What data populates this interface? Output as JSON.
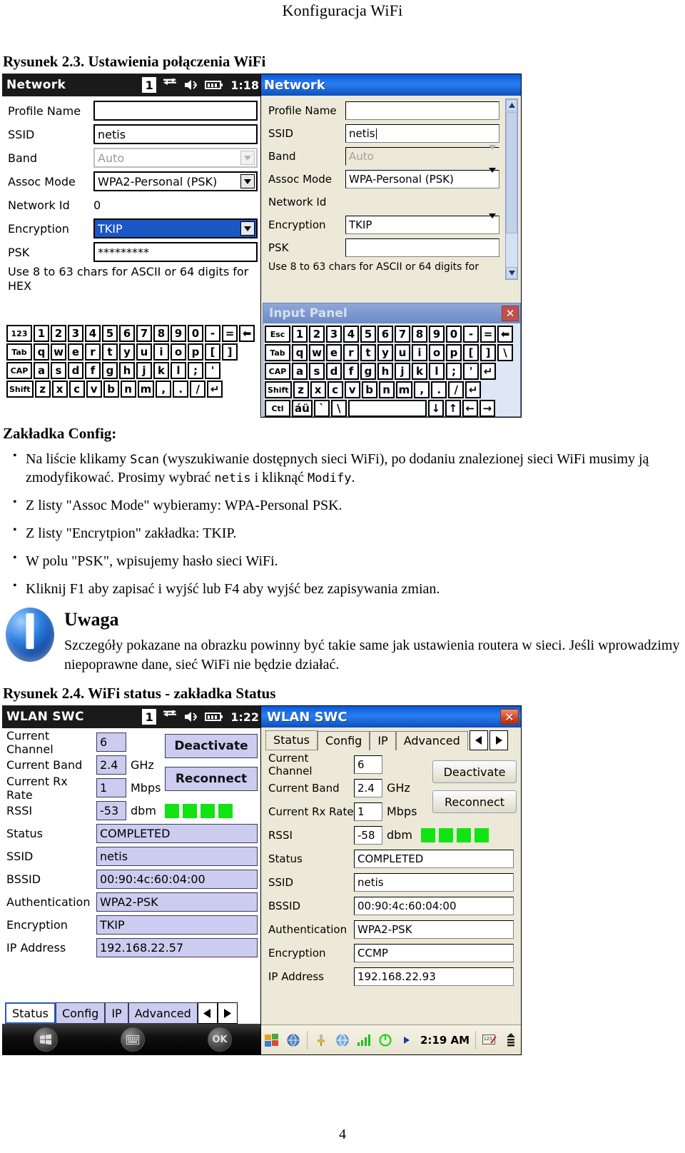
{
  "running_head": "Konfiguracja WiFi",
  "page_number": "4",
  "figure23": {
    "caption": "Rysunek 2.3. Ustawienia połączenia WiFi",
    "handheld": {
      "titlebar": {
        "title": "Network",
        "badge": "1",
        "clock": "1:18"
      },
      "fields": [
        {
          "label": "Profile Name",
          "value": "",
          "type": "text"
        },
        {
          "label": "SSID",
          "value": "netis",
          "type": "text"
        },
        {
          "label": "Band",
          "value": "Auto",
          "type": "combo-disabled"
        },
        {
          "label": "Assoc Mode",
          "value": "WPA2-Personal (PSK)",
          "type": "combo"
        },
        {
          "label": "Network Id",
          "value": "0",
          "type": "plain"
        },
        {
          "label": "Encryption",
          "value": "TKIP",
          "type": "combo-selected"
        },
        {
          "label": "PSK",
          "value": "*********",
          "type": "text"
        }
      ],
      "hint_line1": "Use 8 to 63 chars for ASCII or 64 digits for",
      "hint_line2": "HEX",
      "keyboard": {
        "row1": [
          "123",
          "1",
          "2",
          "3",
          "4",
          "5",
          "6",
          "7",
          "8",
          "9",
          "0",
          "-",
          "=",
          "⬅"
        ],
        "row2": [
          "Tab",
          "q",
          "w",
          "e",
          "r",
          "t",
          "y",
          "u",
          "i",
          "o",
          "p",
          "[",
          "]"
        ],
        "row3": [
          "CAP",
          "a",
          "s",
          "d",
          "f",
          "g",
          "h",
          "j",
          "k",
          "l",
          ";",
          "'"
        ],
        "row4": [
          "Shift",
          "z",
          "x",
          "c",
          "v",
          "b",
          "n",
          "m",
          ",",
          ".",
          "/",
          "↵"
        ]
      }
    },
    "desktop": {
      "titlebar": {
        "title": "Network"
      },
      "fields": [
        {
          "label": "Profile Name",
          "value": "",
          "type": "text"
        },
        {
          "label": "SSID",
          "value": "netis",
          "type": "text-focus"
        },
        {
          "label": "Band",
          "value": "Auto",
          "type": "combo-disabled"
        },
        {
          "label": "Assoc Mode",
          "value": "WPA-Personal (PSK)",
          "type": "combo"
        },
        {
          "label": "Network Id",
          "value": "",
          "type": "plain"
        },
        {
          "label": "Encryption",
          "value": "TKIP",
          "type": "combo"
        },
        {
          "label": "PSK",
          "value": "",
          "type": "text"
        }
      ],
      "hint": "Use 8 to 63 chars for ASCII or 64 digits for",
      "input_panel": {
        "title": "Input Panel",
        "close_label": "✕",
        "row1": [
          "Esc",
          "1",
          "2",
          "3",
          "4",
          "5",
          "6",
          "7",
          "8",
          "9",
          "0",
          "-",
          "=",
          "⬅"
        ],
        "row2": [
          "Tab",
          "q",
          "w",
          "e",
          "r",
          "t",
          "y",
          "u",
          "i",
          "o",
          "p",
          "[",
          "]",
          "\\"
        ],
        "row3": [
          "CAP",
          "a",
          "s",
          "d",
          "f",
          "g",
          "h",
          "j",
          "k",
          "l",
          ";",
          "'",
          "↵"
        ],
        "row4": [
          "Shift",
          "z",
          "x",
          "c",
          "v",
          "b",
          "n",
          "m",
          ",",
          ".",
          "/",
          "↵"
        ],
        "row5": [
          "Ctl",
          "áü",
          "`",
          "\\",
          "",
          "↓",
          "↑",
          "←",
          "→"
        ]
      }
    }
  },
  "config_section": {
    "title": "Zakładka Config:",
    "bullets": [
      {
        "parts": [
          {
            "t": "Na liście klikamy ",
            "mono": false
          },
          {
            "t": "Scan",
            "mono": true
          },
          {
            "t": " (wyszukiwanie dostępnych sieci WiFi), po dodaniu znalezionej sieci WiFi musimy ją zmodyfikować. Prosimy wybrać ",
            "mono": false
          },
          {
            "t": "netis",
            "mono": true
          },
          {
            "t": " i kliknąć ",
            "mono": false
          },
          {
            "t": "Modify",
            "mono": true
          },
          {
            "t": ".",
            "mono": false
          }
        ]
      },
      {
        "parts": [
          {
            "t": "Z listy \"Assoc Mode\" wybieramy: WPA-Personal PSK.",
            "mono": false
          }
        ]
      },
      {
        "parts": [
          {
            "t": "Z listy \"Encrytpion\" zakładka: TKIP.",
            "mono": false
          }
        ]
      },
      {
        "parts": [
          {
            "t": "W polu \"PSK\", wpisujemy hasło sieci WiFi.",
            "mono": false
          }
        ]
      },
      {
        "parts": [
          {
            "t": "Kliknij F1 aby zapisać i wyjść lub F4 aby wyjść bez zapisywania zmian.",
            "mono": false
          }
        ]
      }
    ]
  },
  "note": {
    "icon": "info-icon",
    "title": "Uwaga",
    "text": "Szczegóły pokazane na obrazku powinny być takie same jak ustawienia routera w sieci. Jeśli wprowadzimy niepoprawne dane, sieć WiFi nie będzie działać."
  },
  "figure24": {
    "caption": "Rysunek 2.4. WiFi status - zakładka Status",
    "handheld": {
      "titlebar": {
        "title": "WLAN SWC",
        "badge": "1",
        "clock": "1:22"
      },
      "buttons": {
        "deactivate": "Deactivate",
        "reconnect": "Reconnect"
      },
      "rows": [
        {
          "label": "Current Channel",
          "value": "6",
          "unit": ""
        },
        {
          "label": "Current Band",
          "value": "2.4",
          "unit": "GHz"
        },
        {
          "label": "Current Rx Rate",
          "value": "1",
          "unit": "Mbps"
        },
        {
          "label": "RSSI",
          "value": "-53",
          "unit": "dbm"
        }
      ],
      "signal_bars": 4,
      "info": [
        {
          "label": "Status",
          "value": "COMPLETED"
        },
        {
          "label": "SSID",
          "value": "netis"
        },
        {
          "label": "BSSID",
          "value": "00:90:4c:60:04:00"
        },
        {
          "label": "Authentication",
          "value": "WPA2-PSK"
        },
        {
          "label": "Encryption",
          "value": "TKIP"
        },
        {
          "label": "IP Address",
          "value": "192.168.22.57"
        }
      ],
      "tabs": [
        "Status",
        "Config",
        "IP",
        "Advanced"
      ],
      "active_tab": "Status",
      "taskbar": {
        "start": "start-icon",
        "keyboard": "keyboard-icon",
        "ok": "OK"
      }
    },
    "desktop": {
      "titlebar": {
        "title": "WLAN SWC",
        "close_label": "✕"
      },
      "tabs": [
        "Status",
        "Config",
        "IP",
        "Advanced"
      ],
      "active_tab": "Status",
      "buttons": {
        "deactivate": "Deactivate",
        "reconnect": "Reconnect"
      },
      "rows": [
        {
          "label": "Current Channel",
          "value": "6",
          "unit": ""
        },
        {
          "label": "Current Band",
          "value": "2.4",
          "unit": "GHz"
        },
        {
          "label": "Current Rx Rate",
          "value": "1",
          "unit": "Mbps"
        },
        {
          "label": "RSSI",
          "value": "-58",
          "unit": "dbm"
        }
      ],
      "signal_bars": 4,
      "info": [
        {
          "label": "Status",
          "value": "COMPLETED"
        },
        {
          "label": "SSID",
          "value": "netis"
        },
        {
          "label": "BSSID",
          "value": "00:90:4c:60:04:00"
        },
        {
          "label": "Authentication",
          "value": "WPA2-PSK"
        },
        {
          "label": "Encryption",
          "value": "CCMP"
        },
        {
          "label": "IP Address",
          "value": "192.168.22.93"
        }
      ],
      "taskbar": {
        "clock": "2:19 AM"
      }
    }
  },
  "colors": {
    "titlebar_blue": "#0b58d4",
    "selection_blue": "#1b56c4",
    "field_lavender": "#ccccf0",
    "signal_green": "#12e312",
    "dialog_beige": "#ece9d8"
  }
}
